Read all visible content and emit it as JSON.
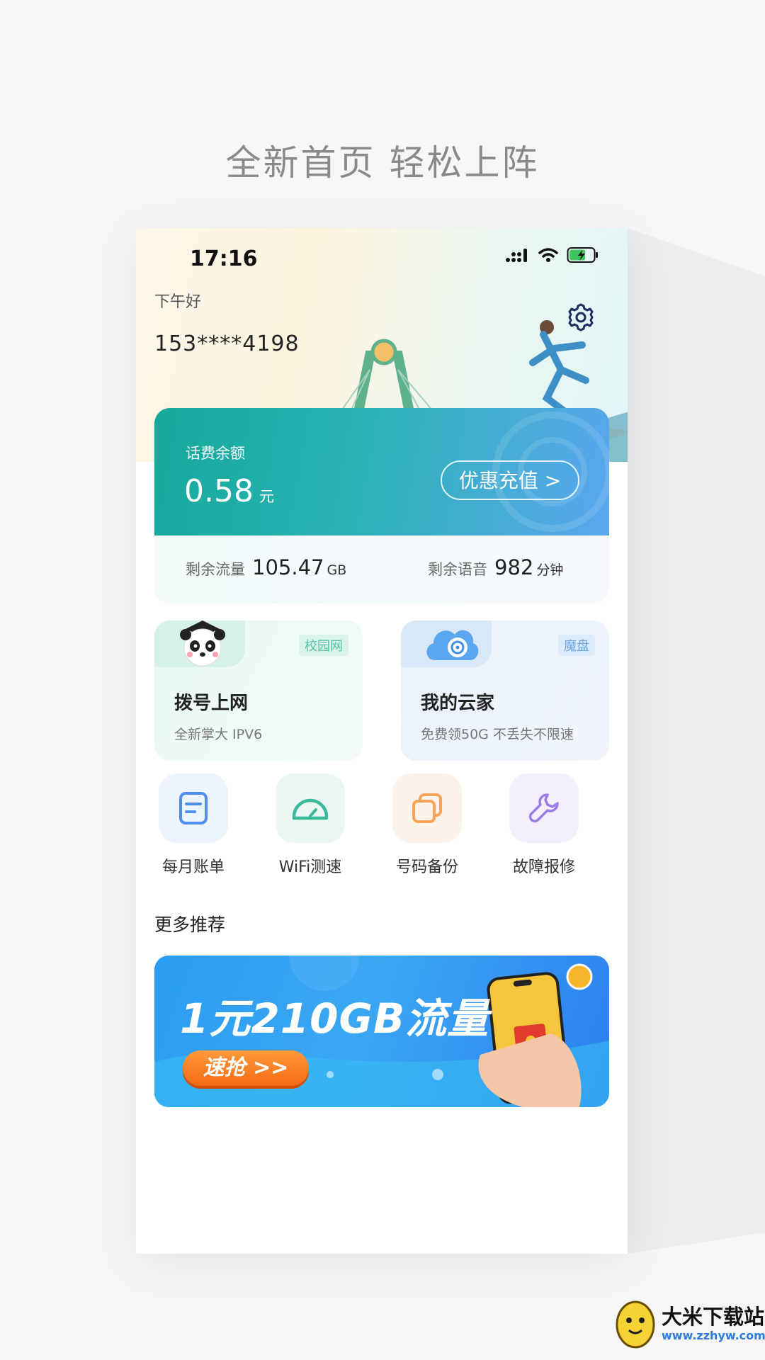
{
  "promo": {
    "title": "全新首页   轻松上阵"
  },
  "status_bar": {
    "time": "17:16"
  },
  "header": {
    "greeting": "下午好",
    "phone_number": "153****4198",
    "settings_icon": "gear-icon"
  },
  "balance": {
    "label": "话费余额",
    "amount": "0.58",
    "unit": "元",
    "topup_label": "优惠充值 >"
  },
  "usage": {
    "data_label": "剩余流量",
    "data_value": "105.47",
    "data_unit": "GB",
    "voice_label": "剩余语音",
    "voice_value": "982",
    "voice_unit": "分钟"
  },
  "services": [
    {
      "title": "拨号上网",
      "subtitle": "全新掌大   IPV6",
      "tag": "校园网",
      "icon": "panda-icon"
    },
    {
      "title": "我的云家",
      "subtitle": "免费领50G   不丢失不限速",
      "tag": "魔盘",
      "icon": "cloud-disk-icon"
    }
  ],
  "quick_actions": [
    {
      "label": "每月账单",
      "icon": "bill-icon",
      "color": "#4f8ff0"
    },
    {
      "label": "WiFi测速",
      "icon": "speedometer-icon",
      "color": "#3cb89a"
    },
    {
      "label": "号码备份",
      "icon": "copy-icon",
      "color": "#f5a45a"
    },
    {
      "label": "故障报修",
      "icon": "wrench-icon",
      "color": "#9a7ee8"
    }
  ],
  "recommend": {
    "title": "更多推荐",
    "banner_text": "1元210GB流量",
    "banner_button": "速抢 >>"
  },
  "watermark": {
    "name": "大米下载站",
    "url": "www.zzhyw.com"
  }
}
